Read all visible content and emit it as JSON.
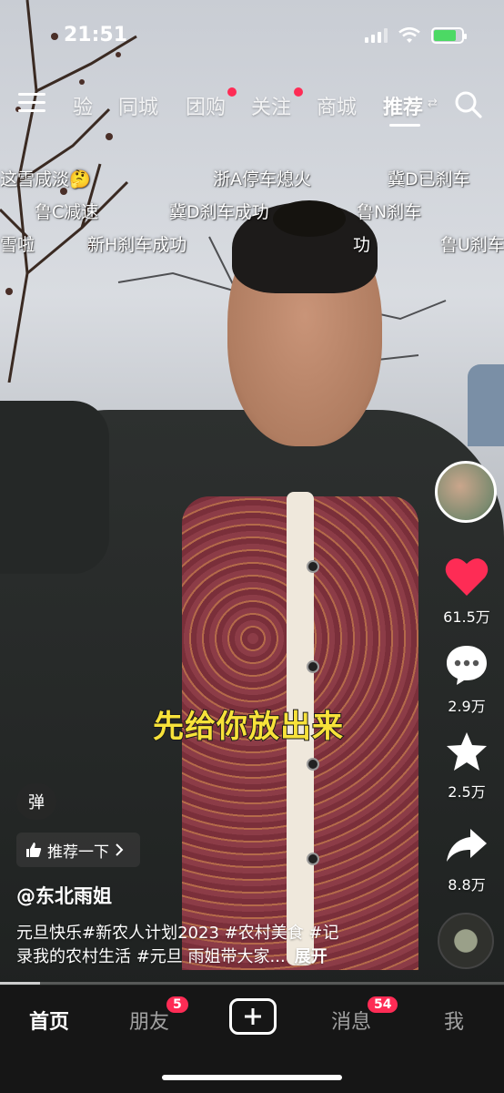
{
  "status_bar": {
    "time": "21:51",
    "battery_level": 0.8
  },
  "top_nav": {
    "tabs": [
      {
        "label": "验",
        "has_dot": false
      },
      {
        "label": "同城",
        "has_dot": false
      },
      {
        "label": "团购",
        "has_dot": true
      },
      {
        "label": "关注",
        "has_dot": true
      },
      {
        "label": "商城",
        "has_dot": false
      },
      {
        "label": "推荐",
        "has_dot": false
      }
    ],
    "active_tab": "推荐",
    "swap_glyph": "⇄"
  },
  "danmu": [
    "这雪咸淡🤔",
    "浙A停车熄火",
    "冀D已刹车",
    "鲁C减速",
    "冀D刹车成功",
    "鲁N刹车",
    "雪啦",
    "新H刹车成功",
    "功",
    "鲁U刹车"
  ],
  "video": {
    "subtitle": "先给你放出来",
    "author": "@东北雨姐",
    "caption_line1": "元旦快乐#新农人计划2023 #农村美食 #记",
    "caption_line2": "录我的农村生活 #元旦 雨姐带大家...",
    "expand_label": "展开",
    "recommend_label": "推荐一下",
    "danmu_toggle_label": "弹",
    "progress": 0.08
  },
  "actions": {
    "likes": "61.5万",
    "comments": "2.9万",
    "favorites": "2.5万",
    "shares": "8.8万"
  },
  "bottom_nav": {
    "home": "首页",
    "friends": "朋友",
    "friends_badge": "5",
    "messages": "消息",
    "messages_badge": "54",
    "me": "我"
  },
  "colors": {
    "accent": "#fe2c55",
    "subtitle": "#f7e23a"
  }
}
